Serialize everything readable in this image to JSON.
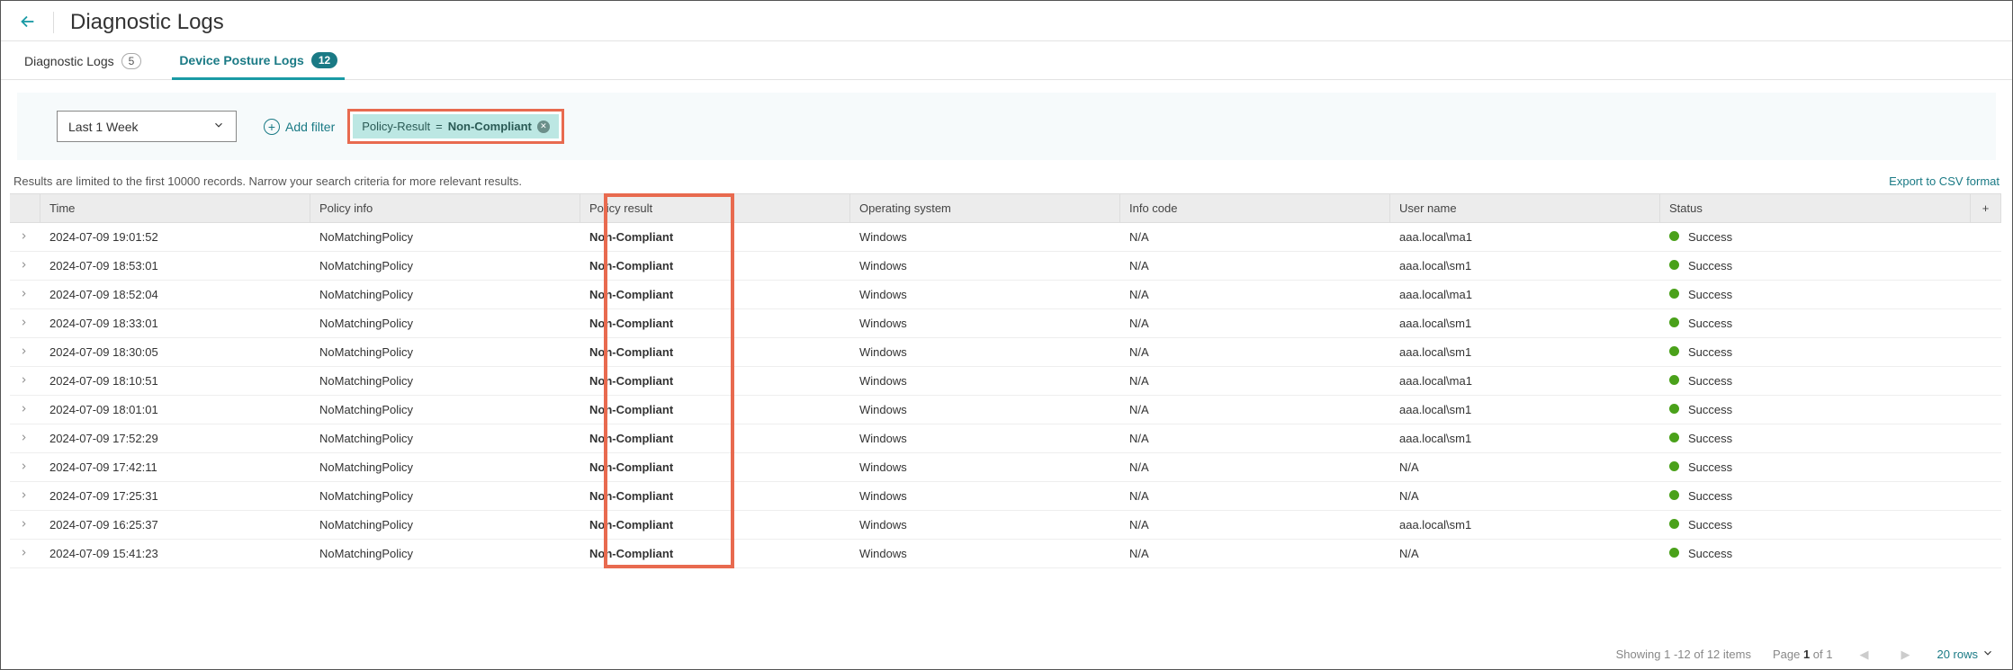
{
  "header": {
    "title": "Diagnostic Logs"
  },
  "tabs": {
    "diag": {
      "label": "Diagnostic Logs",
      "count": "5"
    },
    "dpl": {
      "label": "Device Posture Logs",
      "count": "12"
    }
  },
  "filter": {
    "timeRange": "Last 1 Week",
    "addFilter": "Add filter",
    "chip_field": "Policy-Result",
    "chip_op": "=",
    "chip_value": "Non-Compliant"
  },
  "messages": {
    "limit": "Results are limited to the first 10000 records. Narrow your search criteria for more relevant results.",
    "export": "Export to CSV format"
  },
  "columns": {
    "time": "Time",
    "policy": "Policy info",
    "result": "Policy result",
    "os": "Operating system",
    "info": "Info code",
    "user": "User name",
    "status": "Status"
  },
  "rows": [
    {
      "time": "2024-07-09 19:01:52",
      "policy": "NoMatchingPolicy",
      "result": "Non-Compliant",
      "os": "Windows",
      "info": "N/A",
      "user": "aaa.local\\ma1",
      "status": "Success"
    },
    {
      "time": "2024-07-09 18:53:01",
      "policy": "NoMatchingPolicy",
      "result": "Non-Compliant",
      "os": "Windows",
      "info": "N/A",
      "user": "aaa.local\\sm1",
      "status": "Success"
    },
    {
      "time": "2024-07-09 18:52:04",
      "policy": "NoMatchingPolicy",
      "result": "Non-Compliant",
      "os": "Windows",
      "info": "N/A",
      "user": "aaa.local\\ma1",
      "status": "Success"
    },
    {
      "time": "2024-07-09 18:33:01",
      "policy": "NoMatchingPolicy",
      "result": "Non-Compliant",
      "os": "Windows",
      "info": "N/A",
      "user": "aaa.local\\sm1",
      "status": "Success"
    },
    {
      "time": "2024-07-09 18:30:05",
      "policy": "NoMatchingPolicy",
      "result": "Non-Compliant",
      "os": "Windows",
      "info": "N/A",
      "user": "aaa.local\\sm1",
      "status": "Success"
    },
    {
      "time": "2024-07-09 18:10:51",
      "policy": "NoMatchingPolicy",
      "result": "Non-Compliant",
      "os": "Windows",
      "info": "N/A",
      "user": "aaa.local\\ma1",
      "status": "Success"
    },
    {
      "time": "2024-07-09 18:01:01",
      "policy": "NoMatchingPolicy",
      "result": "Non-Compliant",
      "os": "Windows",
      "info": "N/A",
      "user": "aaa.local\\sm1",
      "status": "Success"
    },
    {
      "time": "2024-07-09 17:52:29",
      "policy": "NoMatchingPolicy",
      "result": "Non-Compliant",
      "os": "Windows",
      "info": "N/A",
      "user": "aaa.local\\sm1",
      "status": "Success"
    },
    {
      "time": "2024-07-09 17:42:11",
      "policy": "NoMatchingPolicy",
      "result": "Non-Compliant",
      "os": "Windows",
      "info": "N/A",
      "user": "N/A",
      "status": "Success"
    },
    {
      "time": "2024-07-09 17:25:31",
      "policy": "NoMatchingPolicy",
      "result": "Non-Compliant",
      "os": "Windows",
      "info": "N/A",
      "user": "N/A",
      "status": "Success"
    },
    {
      "time": "2024-07-09 16:25:37",
      "policy": "NoMatchingPolicy",
      "result": "Non-Compliant",
      "os": "Windows",
      "info": "N/A",
      "user": "aaa.local\\sm1",
      "status": "Success"
    },
    {
      "time": "2024-07-09 15:41:23",
      "policy": "NoMatchingPolicy",
      "result": "Non-Compliant",
      "os": "Windows",
      "info": "N/A",
      "user": "N/A",
      "status": "Success"
    }
  ],
  "footer": {
    "showing": "Showing 1 -12 of 12 items",
    "page_prefix": "Page ",
    "page_cur": "1",
    "page_of": " of 1",
    "rows": "20 rows"
  }
}
